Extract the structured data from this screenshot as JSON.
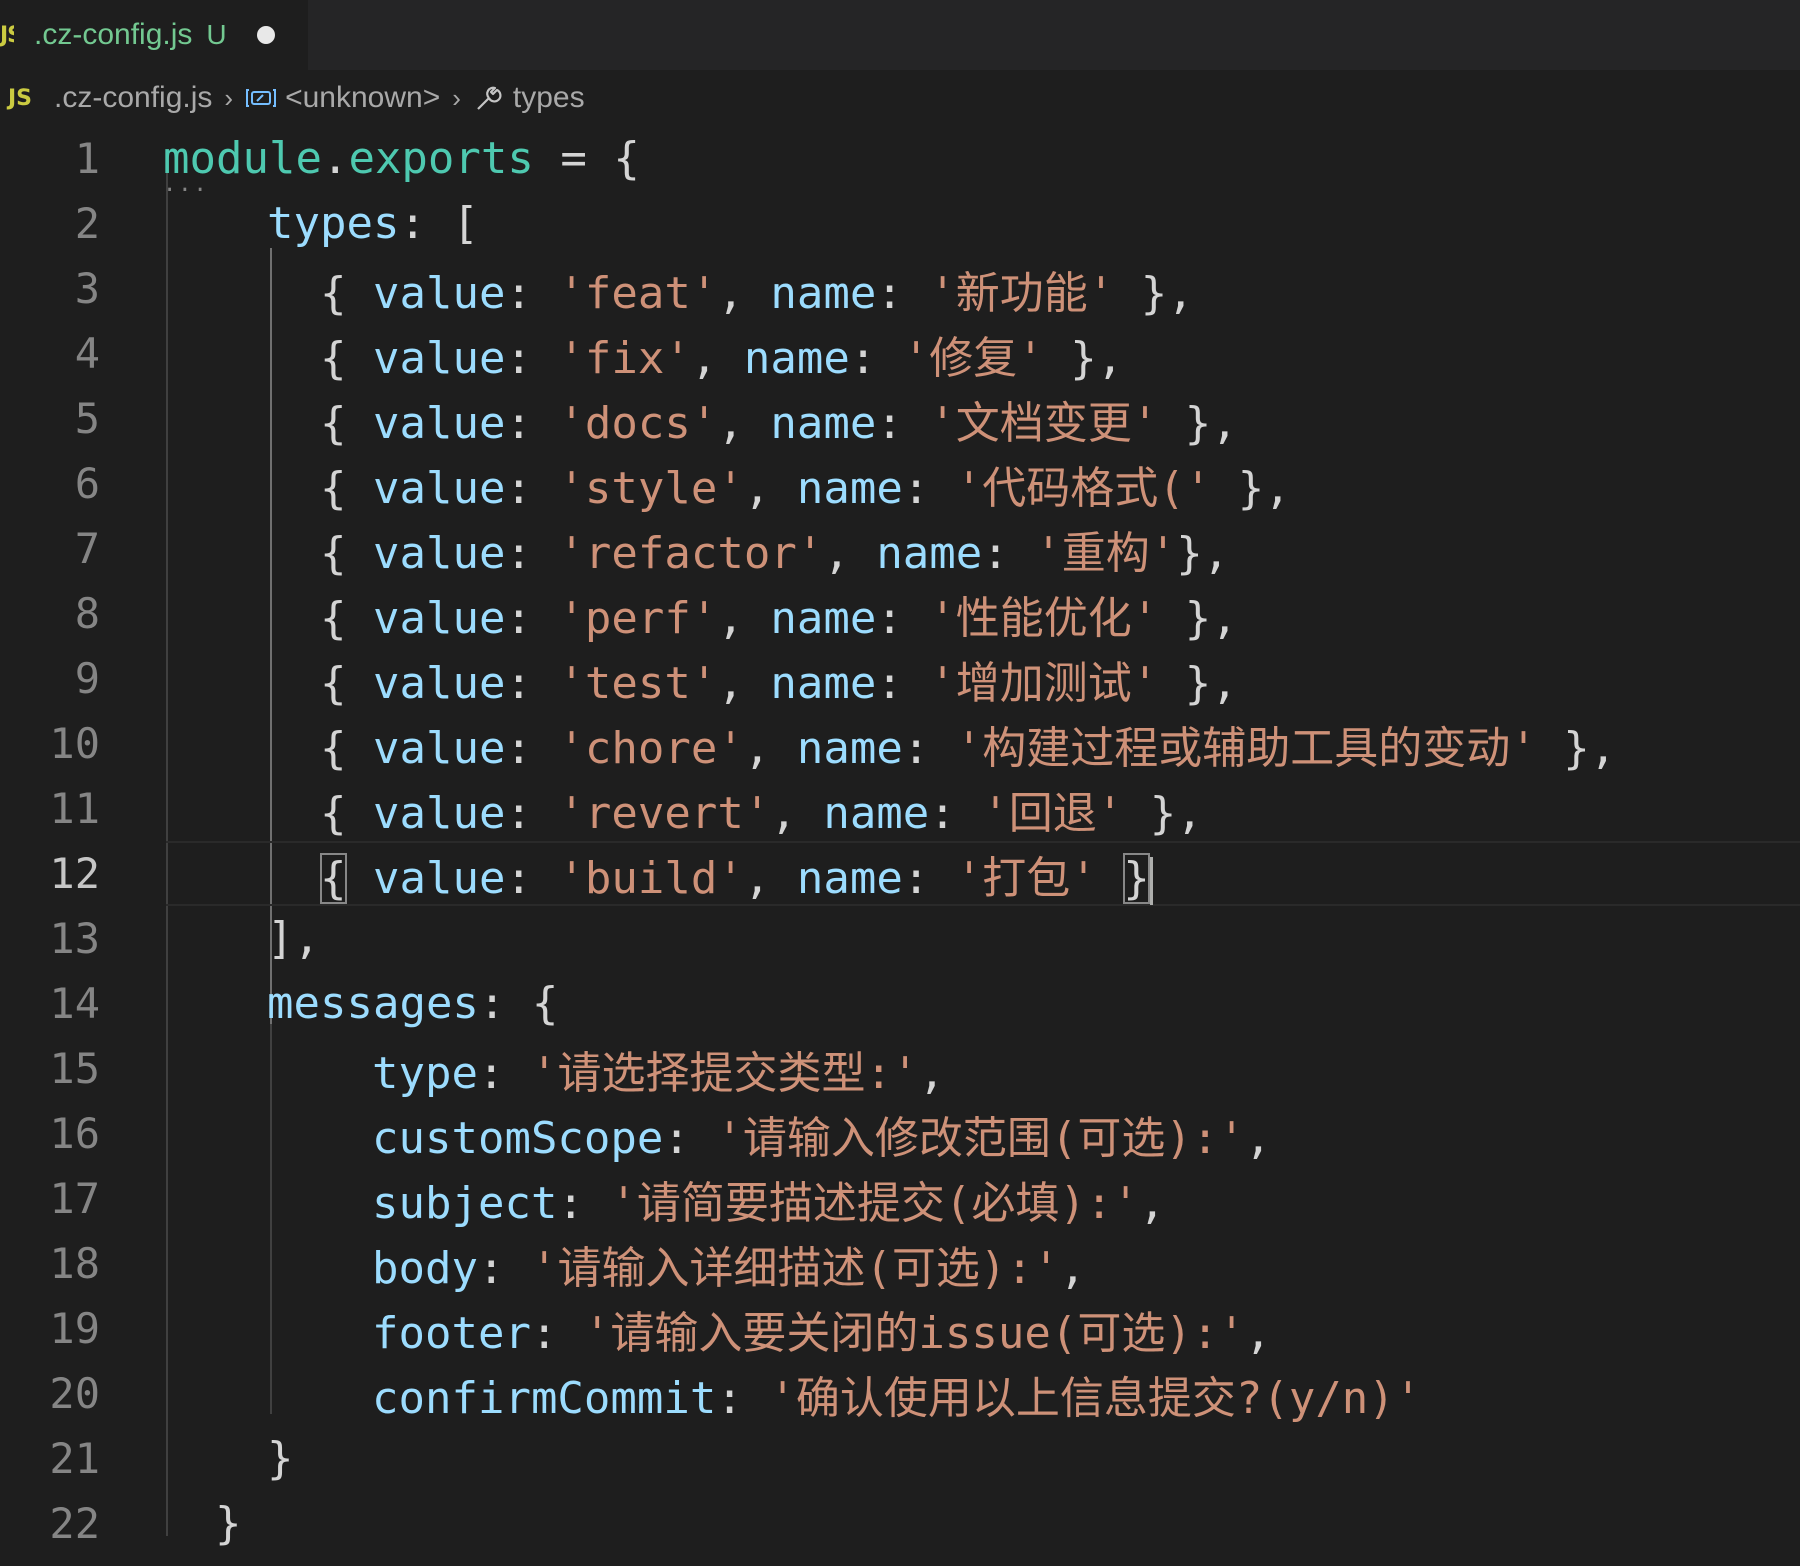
{
  "tab": {
    "icon": "JS",
    "filename": ".cz-config.js",
    "git_status": "U"
  },
  "breadcrumbs": {
    "file_icon": "JS",
    "file": ".cz-config.js",
    "symbol": "<unknown>",
    "property": "types"
  },
  "editor": {
    "current_line": 12,
    "line_numbers": [
      "1",
      "2",
      "3",
      "4",
      "5",
      "6",
      "7",
      "8",
      "9",
      "10",
      "11",
      "12",
      "13",
      "14",
      "15",
      "16",
      "17",
      "18",
      "19",
      "20",
      "21",
      "22"
    ],
    "code": {
      "l1": {
        "a": "module",
        "b": ".",
        "c": "exports",
        "d": " = {"
      },
      "l2": {
        "key": "types",
        "rest": ": ["
      },
      "types": [
        {
          "value": "'feat'",
          "name": "'新功能'",
          "end": " },"
        },
        {
          "value": "'fix'",
          "name": "'修复'",
          "end": " },"
        },
        {
          "value": "'docs'",
          "name": "'文档变更'",
          "end": " },"
        },
        {
          "value": "'style'",
          "name": "'代码格式('",
          "end": " },"
        },
        {
          "value": "'refactor'",
          "name": "'重构'",
          "end": "},"
        },
        {
          "value": "'perf'",
          "name": "'性能优化'",
          "end": " },"
        },
        {
          "value": "'test'",
          "name": "'增加测试'",
          "end": " },"
        },
        {
          "value": "'chore'",
          "name": "'构建过程或辅助工具的变动'",
          "end": " },"
        },
        {
          "value": "'revert'",
          "name": "'回退'",
          "end": " },"
        },
        {
          "value": "'build'",
          "name": "'打包'",
          "end": " }"
        }
      ],
      "l13": "],",
      "l14": {
        "key": "messages",
        "rest": ": {"
      },
      "messages": [
        {
          "key": "type",
          "value": "'请选择提交类型:'",
          "end": ","
        },
        {
          "key": "customScope",
          "value": "'请输入修改范围(可选):'",
          "end": ","
        },
        {
          "key": "subject",
          "value": "'请简要描述提交(必填):'",
          "end": ","
        },
        {
          "key": "body",
          "value": "'请输入详细描述(可选):'",
          "end": ","
        },
        {
          "key": "footer",
          "value": "'请输入要关闭的issue(可选):'",
          "end": ","
        },
        {
          "key": "confirmCommit",
          "value": "'确认使用以上信息提交?(y/n)'",
          "end": ""
        }
      ],
      "l21": "}",
      "l22": "}"
    },
    "token_labels": {
      "value_key": "value",
      "name_key": "name"
    }
  }
}
